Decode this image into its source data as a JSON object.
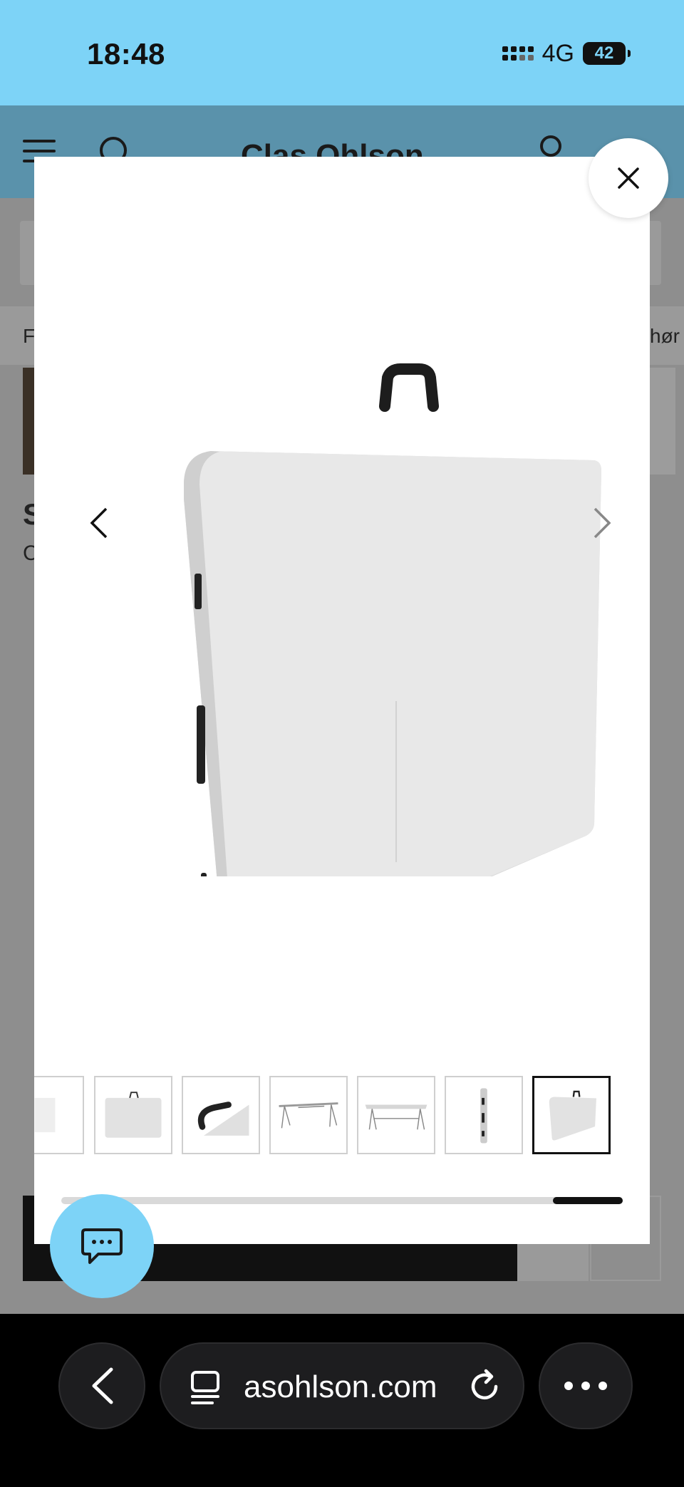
{
  "status_bar": {
    "time": "18:48",
    "network": "4G",
    "battery": "42"
  },
  "site": {
    "brand": "Clas Ohlson"
  },
  "background_page": {
    "tab_left": "F",
    "tab_right": "hør",
    "title_partial": "S",
    "subtitle_partial": "C"
  },
  "gallery": {
    "thumbnail_count": 7,
    "active_thumbnail_index": 6,
    "thumbnails": [
      "partial",
      "folded-table",
      "handle-closeup",
      "table-legs-side",
      "table-legs-front",
      "table-side-profile",
      "folded-table-handle"
    ]
  },
  "browser": {
    "url": "asohlson.com"
  },
  "colors": {
    "accent": "#7dd3f7",
    "header_dimmed": "#5a92ab",
    "overlay": "#8e8e8e"
  },
  "icons": {
    "close": "close-icon",
    "prev": "chevron-left-icon",
    "next": "chevron-right-icon",
    "chat": "chat-icon",
    "back": "chevron-left-icon",
    "reload": "reload-icon",
    "more": "more-icon",
    "tabs": "tabs-icon"
  }
}
